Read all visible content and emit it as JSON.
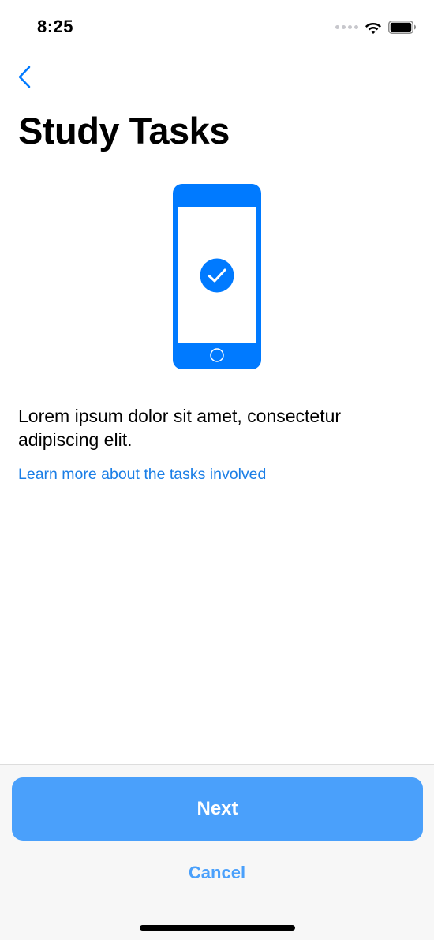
{
  "status_bar": {
    "time": "8:25",
    "icons": [
      "signal-icon",
      "wifi-icon",
      "battery-icon"
    ]
  },
  "nav": {
    "back_icon": "chevron-left-icon"
  },
  "page": {
    "title": "Study Tasks",
    "illustration_icon": "phone-checkmark-icon",
    "body": "Lorem ipsum dolor sit amet, consectetur adipiscing elit.",
    "learn_more": "Learn more about the tasks involved"
  },
  "footer": {
    "next_label": "Next",
    "cancel_label": "Cancel"
  },
  "colors": {
    "accent": "#007aff",
    "button": "#4aa0fb",
    "link": "#1a7ee6",
    "footer_bg": "#f7f7f7"
  }
}
